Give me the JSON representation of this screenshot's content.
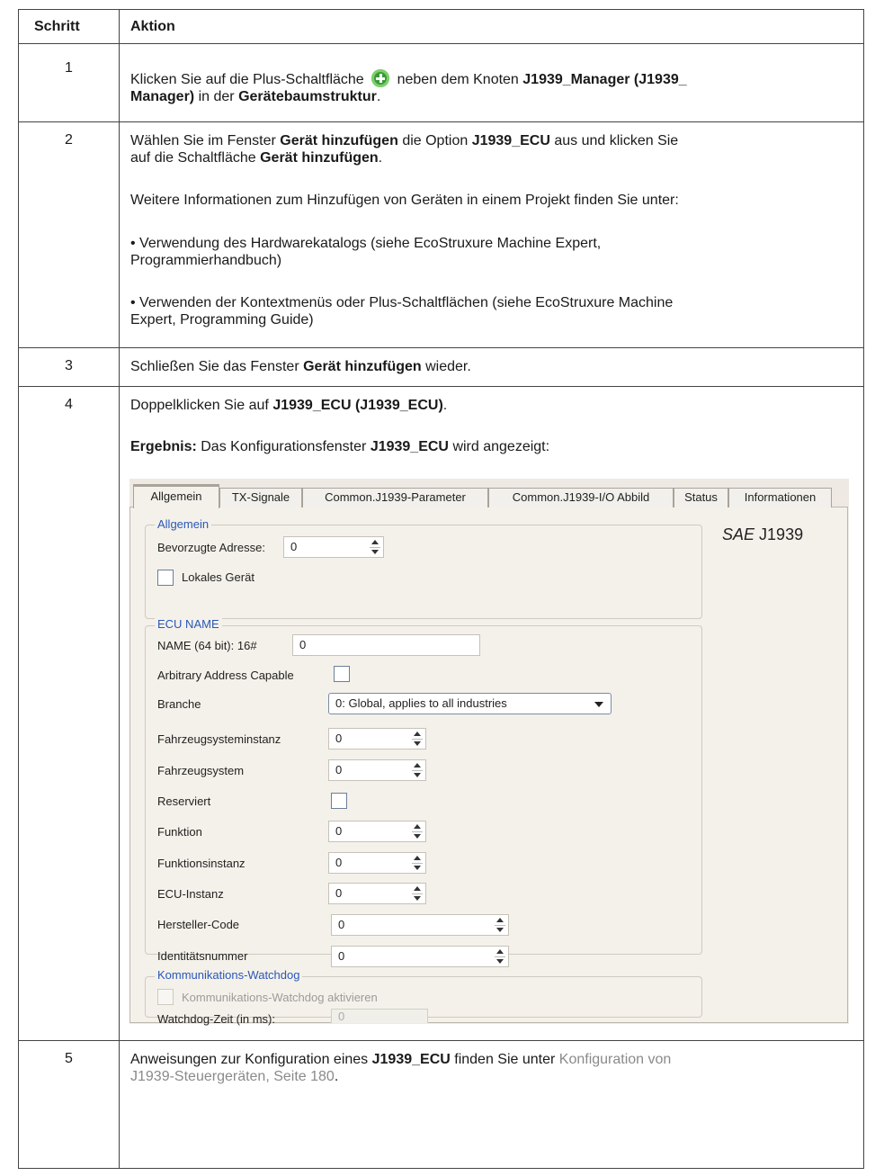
{
  "table": {
    "header_step": "Schritt",
    "header_action": "Aktion",
    "rows": [
      {
        "step": "1",
        "p1_a": "Klicken Sie auf die Plus-Schaltfläche",
        "p1_b": "neben dem Knoten",
        "p1_c": "J1939_Manager (J1939_",
        "p1_d": "Manager)",
        "p1_e": "in der",
        "p1_f": "Gerätebaumstruktur",
        "p1_g": "."
      },
      {
        "step": "2",
        "p1_a": "Wählen Sie im Fenster",
        "p1_b": "Gerät hinzufügen",
        "p1_c": "die Option",
        "p1_d": "J1939_ECU",
        "p1_e": "aus und klicken Sie",
        "p1_f": "auf die Schaltfläche",
        "p1_g": "Gerät hinzufügen",
        "p1_h": ".",
        "p2": "Weitere Informationen zum Hinzufügen von Geräten in einem Projekt finden Sie unter:",
        "p3_a": "• Verwendung des Hardwarekatalogs (siehe EcoStruxure Machine Expert,",
        "p3_b": "Programmierhandbuch)",
        "p4_a": "• Verwenden der Kontextmenüs oder Plus-Schaltflächen (siehe EcoStruxure Machine",
        "p4_b": "Expert, Programming Guide)"
      },
      {
        "step": "3",
        "p1_a": "Schließen Sie das Fenster",
        "p1_b": "Gerät hinzufügen",
        "p1_c": "wieder."
      },
      {
        "step": "4",
        "p1_a": "Doppelklicken Sie auf",
        "p1_b": "J1939_ECU (J1939_ECU)",
        "p1_c": ".",
        "p2_a": "Ergebnis:",
        "p2_b": "Das Konfigurationsfenster",
        "p2_c": "J1939_ECU",
        "p2_d": "wird angezeigt:"
      },
      {
        "step": "5",
        "p1_a": "Anweisungen zur Konfiguration eines",
        "p1_b": "J1939_ECU",
        "p1_c": "finden Sie unter",
        "link_a": "Konfiguration von",
        "link_b": "J1939-Steuergeräten, Seite 180",
        "p1_d": "."
      }
    ]
  },
  "config_window": {
    "tabs": [
      "Allgemein",
      "TX-Signale",
      "Common.J1939-Parameter",
      "Common.J1939-I/O Abbild",
      "Status",
      "Informationen"
    ],
    "active_tab": "Allgemein",
    "sae_prefix": "SAE",
    "sae_suffix": "J1939",
    "general": {
      "title": "Allgemein",
      "preferred_address_label": "Bevorzugte Adresse:",
      "preferred_address_value": "0",
      "local_device_label": "Lokales Gerät"
    },
    "ecu_name": {
      "title": "ECU NAME",
      "name_label": "NAME (64 bit): 16#",
      "name_value": "0",
      "arbitrary_label": "Arbitrary Address Capable",
      "branche_label": "Branche",
      "branche_value": "0: Global, applies to all industries",
      "fahrzeugsysteminstanz_label": "Fahrzeugsysteminstanz",
      "fahrzeugsysteminstanz_value": "0",
      "fahrzeugsystem_label": "Fahrzeugsystem",
      "fahrzeugsystem_value": "0",
      "reserviert_label": "Reserviert",
      "funktion_label": "Funktion",
      "funktion_value": "0",
      "funktionsinstanz_label": "Funktionsinstanz",
      "funktionsinstanz_value": "0",
      "ecu_instanz_label": "ECU-Instanz",
      "ecu_instanz_value": "0",
      "hersteller_label": "Hersteller-Code",
      "hersteller_value": "0",
      "identitaet_label": "Identitätsnummer",
      "identitaet_value": "0"
    },
    "watchdog": {
      "title": "Kommunikations-Watchdog",
      "enable_label": "Kommunikations-Watchdog aktivieren",
      "time_label": "Watchdog-Zeit (in ms):",
      "time_value": "0"
    }
  }
}
